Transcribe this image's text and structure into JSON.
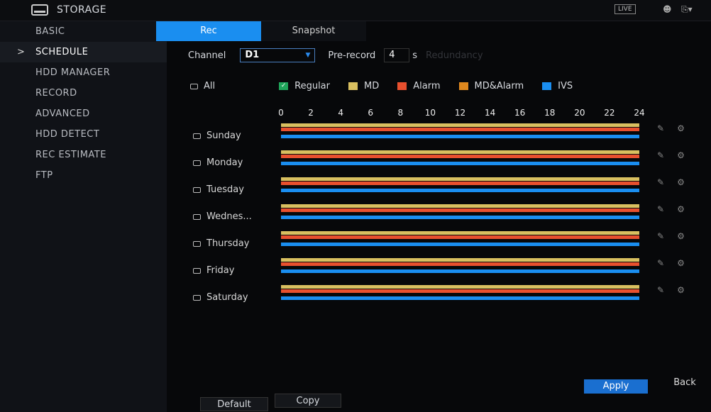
{
  "header": {
    "title": "STORAGE",
    "live_label": "LIVE"
  },
  "sidebar": {
    "items": [
      {
        "label": "BASIC",
        "active": false
      },
      {
        "label": "SCHEDULE",
        "active": true
      },
      {
        "label": "HDD MANAGER",
        "active": false
      },
      {
        "label": "RECORD",
        "active": false
      },
      {
        "label": "ADVANCED",
        "active": false
      },
      {
        "label": "HDD DETECT",
        "active": false
      },
      {
        "label": "REC ESTIMATE",
        "active": false
      },
      {
        "label": "FTP",
        "active": false
      }
    ]
  },
  "tabs": [
    {
      "label": "Rec",
      "active": true
    },
    {
      "label": "Snapshot",
      "active": false
    }
  ],
  "controls": {
    "channel_label": "Channel",
    "channel_value": "D1",
    "prerecord_label": "Pre-record",
    "prerecord_value": "4",
    "prerecord_unit": "s",
    "redundancy_label": "Redundancy"
  },
  "legend": {
    "all_label": "All",
    "items": [
      {
        "label": "Regular",
        "color": "#1fa45a",
        "checked": true
      },
      {
        "label": "MD",
        "color": "#d9c060"
      },
      {
        "label": "Alarm",
        "color": "#e8502e"
      },
      {
        "label": "MD&Alarm",
        "color": "#e0891e"
      },
      {
        "label": "IVS",
        "color": "#1a8ef0"
      }
    ]
  },
  "hours": [
    "0",
    "2",
    "4",
    "6",
    "8",
    "10",
    "12",
    "14",
    "16",
    "18",
    "20",
    "22",
    "24"
  ],
  "days": [
    {
      "label": "Sunday",
      "periods": [
        {
          "type": "MD",
          "start": 0,
          "end": 24
        },
        {
          "type": "Alarm",
          "start": 0,
          "end": 24
        },
        {
          "type": "IVS",
          "start": 0,
          "end": 24
        }
      ]
    },
    {
      "label": "Monday",
      "periods": [
        {
          "type": "MD",
          "start": 0,
          "end": 24
        },
        {
          "type": "Alarm",
          "start": 0,
          "end": 24
        },
        {
          "type": "IVS",
          "start": 0,
          "end": 24
        }
      ]
    },
    {
      "label": "Tuesday",
      "periods": [
        {
          "type": "MD",
          "start": 0,
          "end": 24
        },
        {
          "type": "Alarm",
          "start": 0,
          "end": 24
        },
        {
          "type": "IVS",
          "start": 0,
          "end": 24
        }
      ]
    },
    {
      "label": "Wednes...",
      "periods": [
        {
          "type": "MD",
          "start": 0,
          "end": 24
        },
        {
          "type": "Alarm",
          "start": 0,
          "end": 24
        },
        {
          "type": "IVS",
          "start": 0,
          "end": 24
        }
      ]
    },
    {
      "label": "Thursday",
      "periods": [
        {
          "type": "MD",
          "start": 0,
          "end": 24
        },
        {
          "type": "Alarm",
          "start": 0,
          "end": 24
        },
        {
          "type": "IVS",
          "start": 0,
          "end": 24
        }
      ]
    },
    {
      "label": "Friday",
      "periods": [
        {
          "type": "MD",
          "start": 0,
          "end": 24
        },
        {
          "type": "Alarm",
          "start": 0,
          "end": 24
        },
        {
          "type": "IVS",
          "start": 0,
          "end": 24
        }
      ]
    },
    {
      "label": "Saturday",
      "periods": [
        {
          "type": "MD",
          "start": 0,
          "end": 24
        },
        {
          "type": "Alarm",
          "start": 0,
          "end": 24
        },
        {
          "type": "IVS",
          "start": 0,
          "end": 24
        }
      ]
    }
  ],
  "buttons": {
    "default": "Default",
    "copy": "Copy",
    "apply": "Apply",
    "back": "Back"
  }
}
